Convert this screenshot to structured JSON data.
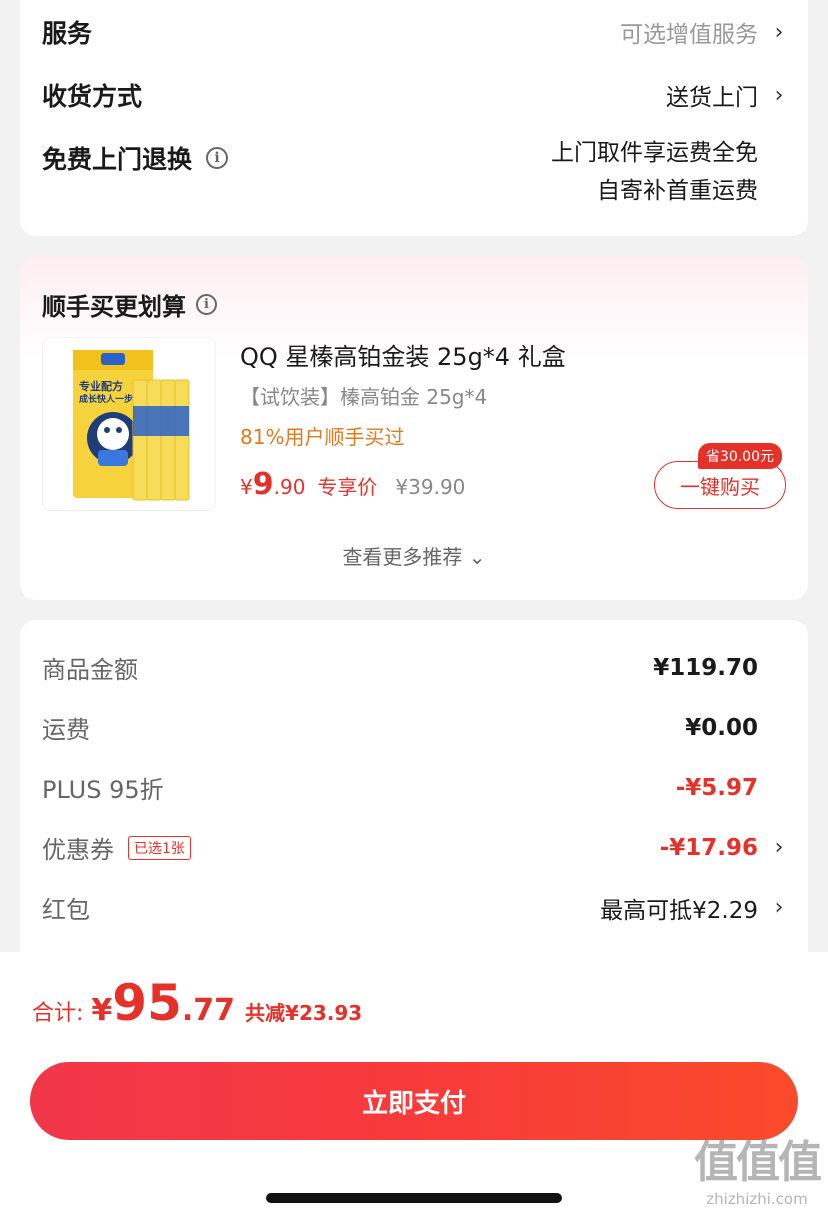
{
  "services": {
    "rows": [
      {
        "title": "服务",
        "value_lines": [
          "可选增值服务"
        ],
        "chevron": true
      },
      {
        "title": "收货方式",
        "value_lines": [
          "送货上门"
        ],
        "chevron": true
      },
      {
        "title": "免费上门退换",
        "value_lines": [
          "上门取件享运费全免",
          "自寄补首重运费"
        ],
        "chevron": false,
        "info_icon": true
      }
    ]
  },
  "upsell": {
    "title": "顺手买更划算",
    "product": {
      "name": "QQ 星榛高铂金装 25g*4 礼盒",
      "subtitle": "【试饮装】榛高铂金 25g*4",
      "stat": "81%用户顺手买过",
      "price_symbol": "¥",
      "price_int": "9",
      "price_dec": ".90",
      "price_tag": "专享价",
      "original_price": "¥39.90",
      "save_badge": "省30.00元",
      "buy_label": "一键购买",
      "thumb_text_line1": "专业配方",
      "thumb_text_line2": "成长快人一步"
    },
    "more_label": "查看更多推荐 ⌄"
  },
  "summary": {
    "rows": [
      {
        "label": "商品金额",
        "value": "¥119.70",
        "red": false,
        "chevron": false
      },
      {
        "label": "运费",
        "value": "¥0.00",
        "red": false,
        "chevron": false
      },
      {
        "label": "PLUS 95折",
        "value": "-¥5.97",
        "red": true,
        "chevron": false
      },
      {
        "label": "优惠券",
        "tag": "已选1张",
        "value": "-¥17.96",
        "red": true,
        "chevron": true
      },
      {
        "label": "红包",
        "value": "最高可抵¥2.29",
        "red": false,
        "chevron": true
      }
    ]
  },
  "footer": {
    "total_label": "合计:",
    "total_symbol": "¥",
    "total_int": "95",
    "total_dec": ".77",
    "reduce_label": "共减¥23.93",
    "pay_label": "立即支付"
  },
  "watermark": {
    "big": "值值值",
    "small": "zhizhizhi.com"
  },
  "colors": {
    "accent_red": "#e4322b",
    "stat_orange": "#e07a1f",
    "pay_gradient_start": "#f2364a",
    "pay_gradient_end": "#fa4a2a"
  }
}
